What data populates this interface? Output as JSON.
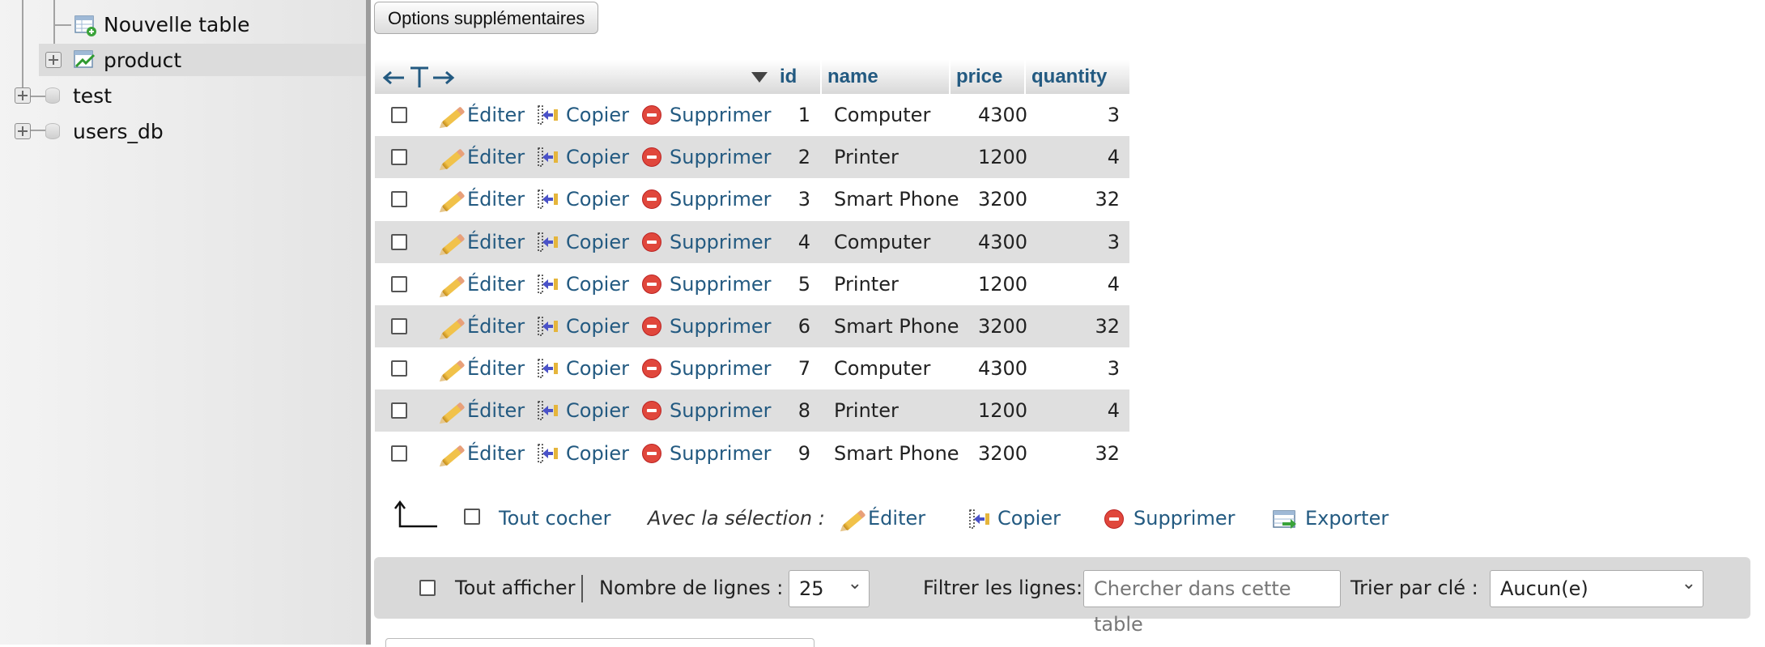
{
  "navigation": {
    "items": [
      {
        "label": "Nouvelle table",
        "icon": "new-table-icon"
      },
      {
        "label": "product",
        "icon": "table-icon",
        "active": true
      },
      {
        "label": "test",
        "icon": "database-icon"
      },
      {
        "label": "users_db",
        "icon": "database-icon"
      }
    ]
  },
  "toolbar": {
    "options_label": "Options supplémentaires"
  },
  "table": {
    "columns": [
      "id",
      "name",
      "price",
      "quantity"
    ],
    "actions": {
      "edit": "Éditer",
      "copy": "Copier",
      "delete": "Supprimer"
    },
    "rows": [
      {
        "id": "1",
        "name": "Computer",
        "price": "4300",
        "quantity": "3"
      },
      {
        "id": "2",
        "name": "Printer",
        "price": "1200",
        "quantity": "4"
      },
      {
        "id": "3",
        "name": "Smart Phone",
        "price": "3200",
        "quantity": "32"
      },
      {
        "id": "4",
        "name": "Computer",
        "price": "4300",
        "quantity": "3"
      },
      {
        "id": "5",
        "name": "Printer",
        "price": "1200",
        "quantity": "4"
      },
      {
        "id": "6",
        "name": "Smart Phone",
        "price": "3200",
        "quantity": "32"
      },
      {
        "id": "7",
        "name": "Computer",
        "price": "4300",
        "quantity": "3"
      },
      {
        "id": "8",
        "name": "Printer",
        "price": "1200",
        "quantity": "4"
      },
      {
        "id": "9",
        "name": "Smart Phone",
        "price": "3200",
        "quantity": "32"
      }
    ]
  },
  "selection": {
    "check_all": "Tout cocher",
    "with_selection": "Avec la sélection :",
    "edit": "Éditer",
    "copy": "Copier",
    "delete": "Supprimer",
    "export": "Exporter"
  },
  "navbar": {
    "show_all": "Tout afficher",
    "rows_label": "Nombre de lignes :",
    "rows_value": "25",
    "filter_label": "Filtrer les lignes:",
    "filter_placeholder": "Chercher dans cette table",
    "sort_label": "Trier par clé :",
    "sort_value": "Aucun(e)"
  },
  "colors": {
    "link": "#235a81",
    "row_alt": "#dfdfdf",
    "delete_red": "#e0473c"
  }
}
